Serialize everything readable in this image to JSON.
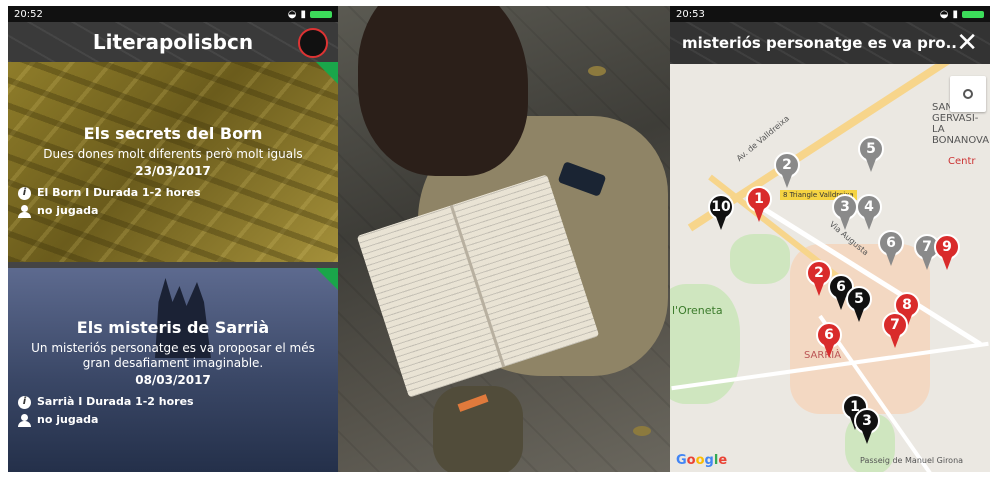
{
  "left_screen": {
    "status_time": "20:52",
    "app_title": "Literapolisbcn",
    "cards": [
      {
        "title": "Els secrets del Born",
        "subtitle": "Dues dones molt diferents però molt iguals",
        "date": "23/03/2017",
        "location": "El Born I Durada 1-2 hores",
        "status": "no jugada"
      },
      {
        "title": "Els misteris de Sarrià",
        "subtitle": "Un misteriós personatge es va proposar el més gran desafiament imaginable.",
        "date": "08/03/2017",
        "location": "Sarrià I Durada 1-2 hores",
        "status": "no jugada"
      }
    ]
  },
  "right_screen": {
    "status_time": "20:53",
    "title": "misteriós personatge es va pro...",
    "close_icon": "close-icon",
    "map_labels": {
      "sant_gervasi": "SANT GERVASI-LA BONANOVA",
      "centre": "Centr",
      "oreneta": "l'Oreneta",
      "sarria": "SARRIÀ",
      "badge": "8 Triangle Valldreixa",
      "google": "Google",
      "av_valldreixa": "Av. de Valldreixa",
      "via_augusta": "Via Augusta",
      "manuel_girona": "Passeig de Manuel Girona"
    },
    "pins": [
      {
        "label": "1",
        "color": "red"
      },
      {
        "label": "2",
        "color": "gray"
      },
      {
        "label": "5",
        "color": "gray"
      },
      {
        "label": "10",
        "color": "black"
      },
      {
        "label": "3",
        "color": "gray"
      },
      {
        "label": "4",
        "color": "gray"
      },
      {
        "label": "6",
        "color": "gray"
      },
      {
        "label": "7",
        "color": "gray"
      },
      {
        "label": "9",
        "color": "red"
      },
      {
        "label": "2",
        "color": "red"
      },
      {
        "label": "6",
        "color": "black"
      },
      {
        "label": "5",
        "color": "black"
      },
      {
        "label": "8",
        "color": "red"
      },
      {
        "label": "7",
        "color": "red"
      },
      {
        "label": "6",
        "color": "red"
      },
      {
        "label": "1",
        "color": "black"
      },
      {
        "label": "3",
        "color": "black"
      }
    ]
  }
}
